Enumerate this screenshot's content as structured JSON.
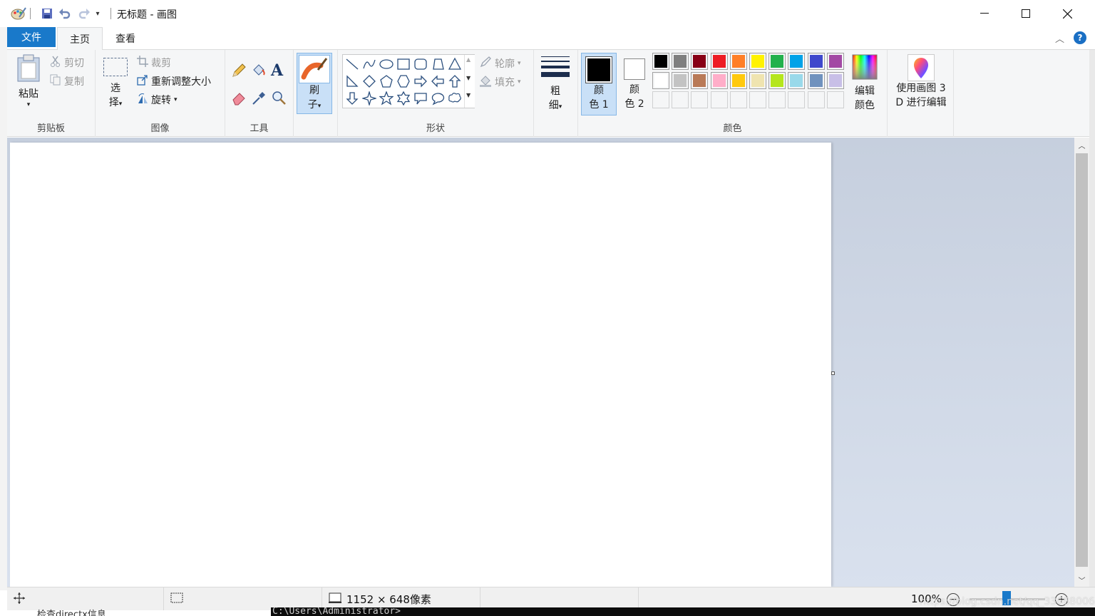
{
  "window": {
    "title": "无标题 - 画图",
    "controls": {
      "minimize": "—",
      "maximize": "☐",
      "close": "✕"
    }
  },
  "quick_access": {
    "items": [
      "save-icon",
      "undo-icon",
      "redo-icon",
      "customize-dropdown-icon"
    ]
  },
  "tabs": {
    "file": "文件",
    "home": "主页",
    "view": "查看",
    "active": "主页"
  },
  "ribbon": {
    "clipboard": {
      "label": "剪贴板",
      "paste": "粘贴",
      "cut": "剪切",
      "copy": "复制"
    },
    "image": {
      "label": "图像",
      "select_top": "选",
      "select_bottom": "择",
      "crop": "裁剪",
      "resize": "重新调整大小",
      "rotate": "旋转"
    },
    "tools": {
      "label": "工具"
    },
    "brushes": {
      "top": "刷",
      "bottom": "子"
    },
    "shapes": {
      "label": "形状",
      "outline": "轮廓",
      "fill": "填充"
    },
    "size": {
      "top": "粗",
      "bottom": "细"
    },
    "colors": {
      "label": "颜色",
      "color1_top": "颜",
      "color1_bottom": "色 1",
      "color2_top": "颜",
      "color2_bottom": "色 2",
      "edit_top": "编辑",
      "edit_bottom": "颜色",
      "color1": "#000000",
      "color2": "#ffffff",
      "palette_row1": [
        "#000000",
        "#7f7f7f",
        "#880015",
        "#ed1c24",
        "#ff7f27",
        "#fff200",
        "#22b14c",
        "#00a2e8",
        "#3f48cc",
        "#a349a4"
      ],
      "palette_row2": [
        "#ffffff",
        "#c3c3c3",
        "#b97a57",
        "#ffaec9",
        "#ffc90e",
        "#efe4b0",
        "#b5e61d",
        "#99d9ea",
        "#7092be",
        "#c8bfe7"
      ]
    },
    "paint3d": {
      "line1": "使用画图 3",
      "line2": "D 进行编辑"
    }
  },
  "status": {
    "dimensions": "1152 × 648像素",
    "zoom": "100%"
  },
  "background": {
    "left_text": "检查directx信息",
    "console_text": "C:\\Users\\Administrator>",
    "watermark": "https://blog.csdn.net/qq_33688006"
  }
}
